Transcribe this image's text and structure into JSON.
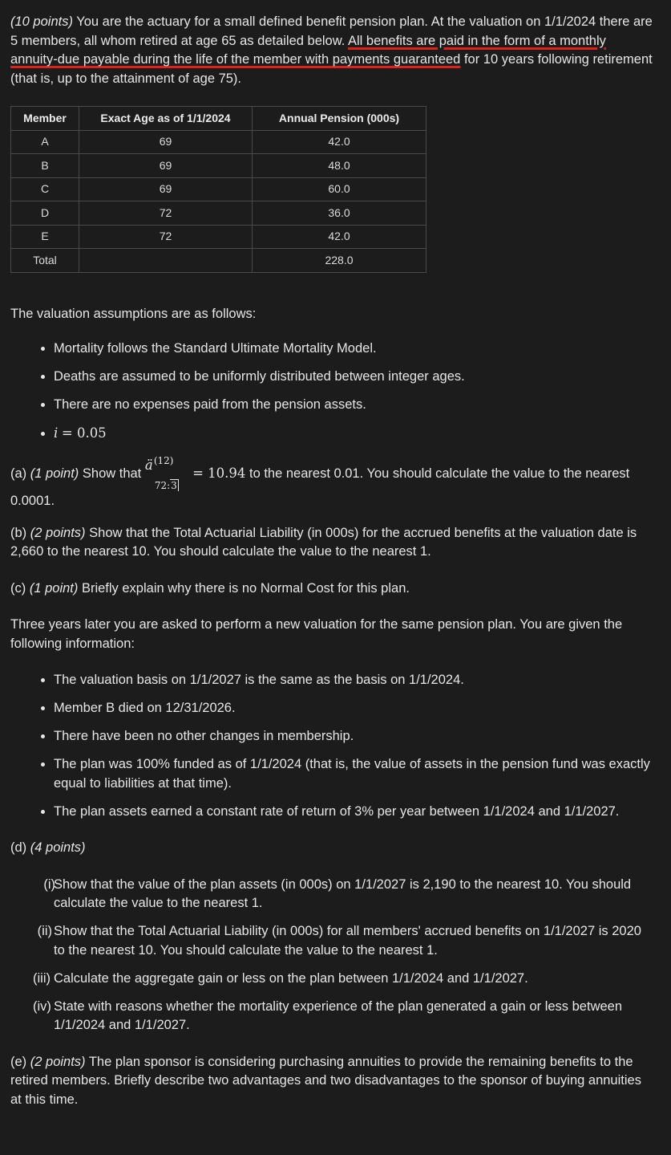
{
  "intro": {
    "points": "(10 points)",
    "text_before": " You are the actuary for a small defined benefit pension plan. At the valuation on 1/1/2024 there are 5 members, all whom retired at age 65 as detailed below. ",
    "underlined": "All benefits are paid in the form of a monthly annuity-due payable during the life of the member with payments guaranteed",
    "text_after": " for 10 years following retirement (that is, up to the attainment of age 75)."
  },
  "table": {
    "headers": [
      "Member",
      "Exact Age as of 1/1/2024",
      "Annual Pension (000s)"
    ],
    "rows": [
      [
        "A",
        "69",
        "42.0"
      ],
      [
        "B",
        "69",
        "48.0"
      ],
      [
        "C",
        "69",
        "60.0"
      ],
      [
        "D",
        "72",
        "36.0"
      ],
      [
        "E",
        "72",
        "42.0"
      ],
      [
        "Total",
        "",
        "228.0"
      ]
    ]
  },
  "assumptions": {
    "heading": "The valuation assumptions are as follows:",
    "items": [
      "Mortality follows the Standard Ultimate Mortality Model.",
      "Deaths are assumed to be uniformly distributed between integer ages.",
      "There are no expenses paid from the pension assets."
    ],
    "interest_lhs": "i",
    "interest_rhs": "= 0.05"
  },
  "part_a": {
    "label": "(a)",
    "points": "(1 point)",
    "pre": " Show that ",
    "annuity_symbol": "ä",
    "annuity_sup": "(12)",
    "annuity_sub_age": "72:",
    "annuity_sub_term": "3",
    "eq": " = 10.94",
    "post": " to the nearest 0.01. You should calculate the value to the nearest 0.0001."
  },
  "part_b": {
    "label": "(b)",
    "points": "(2 points)",
    "text": " Show that the Total Actuarial Liability (in 000s) for the accrued benefits at the valuation date is 2,660 to the nearest 10. You should calculate the value to the nearest 1."
  },
  "part_c": {
    "label": "(c)",
    "points": "(1 point)",
    "text": " Briefly explain why there is no Normal Cost for this plan."
  },
  "three_years": "Three years later you are asked to perform a new valuation for the same pension plan. You are given the following information:",
  "info_items": [
    "The valuation basis on 1/1/2027 is the same as the basis on 1/1/2024.",
    "Member B died on 12/31/2026.",
    "There have been no other changes in membership.",
    "The plan was 100% funded as of 1/1/2024 (that is, the value of assets in the pension fund was exactly equal to liabilities at that time).",
    "The plan assets earned a constant rate of return of 3% per year between 1/1/2024 and 1/1/2027."
  ],
  "part_d": {
    "label": "(d)",
    "points": "(4 points)",
    "items": [
      {
        "num": "(i)",
        "text": "Show that the value of the plan assets (in 000s) on 1/1/2027 is 2,190 to the nearest 10. You should calculate the value to the nearest 1."
      },
      {
        "num": "(ii)",
        "text": "Show that the Total Actuarial Liability (in 000s) for all members' accrued benefits on 1/1/2027 is 2020 to the nearest 10. You should calculate the value to the nearest 1."
      },
      {
        "num": "(iii)",
        "text": "Calculate the aggregate gain or less on the plan between 1/1/2024 and 1/1/2027."
      },
      {
        "num": "(iv)",
        "text": "State with reasons whether the mortality experience of the plan generated a gain or less between 1/1/2024 and 1/1/2027."
      }
    ]
  },
  "part_e": {
    "label": "(e)",
    "points": "(2 points)",
    "text": " The plan sponsor is considering purchasing annuities to provide the remaining benefits to the retired members. Briefly describe two advantages and two disadvantages to the sponsor of buying annuities at this time."
  },
  "colors": {
    "background": "#1c1c1c",
    "text": "#e6e6e6",
    "underline": "#e0201c",
    "table_border": "#4a4a4a"
  }
}
